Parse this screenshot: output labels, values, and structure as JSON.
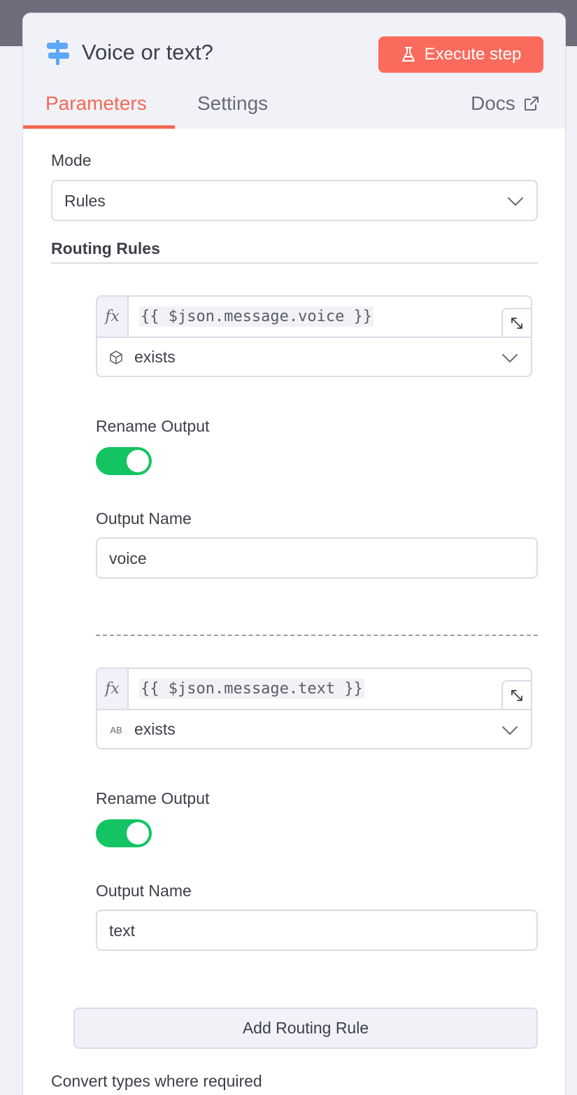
{
  "node": {
    "title": "Voice or text?",
    "icon": "signpost-icon",
    "execute_label": "Execute step"
  },
  "tabs": {
    "parameters": "Parameters",
    "settings": "Settings",
    "docs": "Docs",
    "active": "Parameters"
  },
  "mode": {
    "label": "Mode",
    "value": "Rules"
  },
  "routing": {
    "title": "Routing Rules",
    "rules": [
      {
        "fx": "fx",
        "expression": "{{ $json.message.voice }}",
        "type_icon": "cube-icon",
        "operator": "exists",
        "rename_label": "Rename Output",
        "rename_on": true,
        "output_name_label": "Output Name",
        "output_name": "voice"
      },
      {
        "fx": "fx",
        "expression": "{{ $json.message.text }}",
        "type_icon": "string-type-icon",
        "type_glyph": "AB",
        "operator": "exists",
        "rename_label": "Rename Output",
        "rename_on": true,
        "output_name_label": "Output Name",
        "output_name": "text"
      }
    ],
    "add_label": "Add Routing Rule"
  },
  "options": {
    "convert_label": "Convert types where required"
  },
  "colors": {
    "accent": "#f46a55",
    "execute_bg": "#fa6b5d",
    "toggle_on": "#14c462",
    "node_icon": "#5fa8f7"
  }
}
